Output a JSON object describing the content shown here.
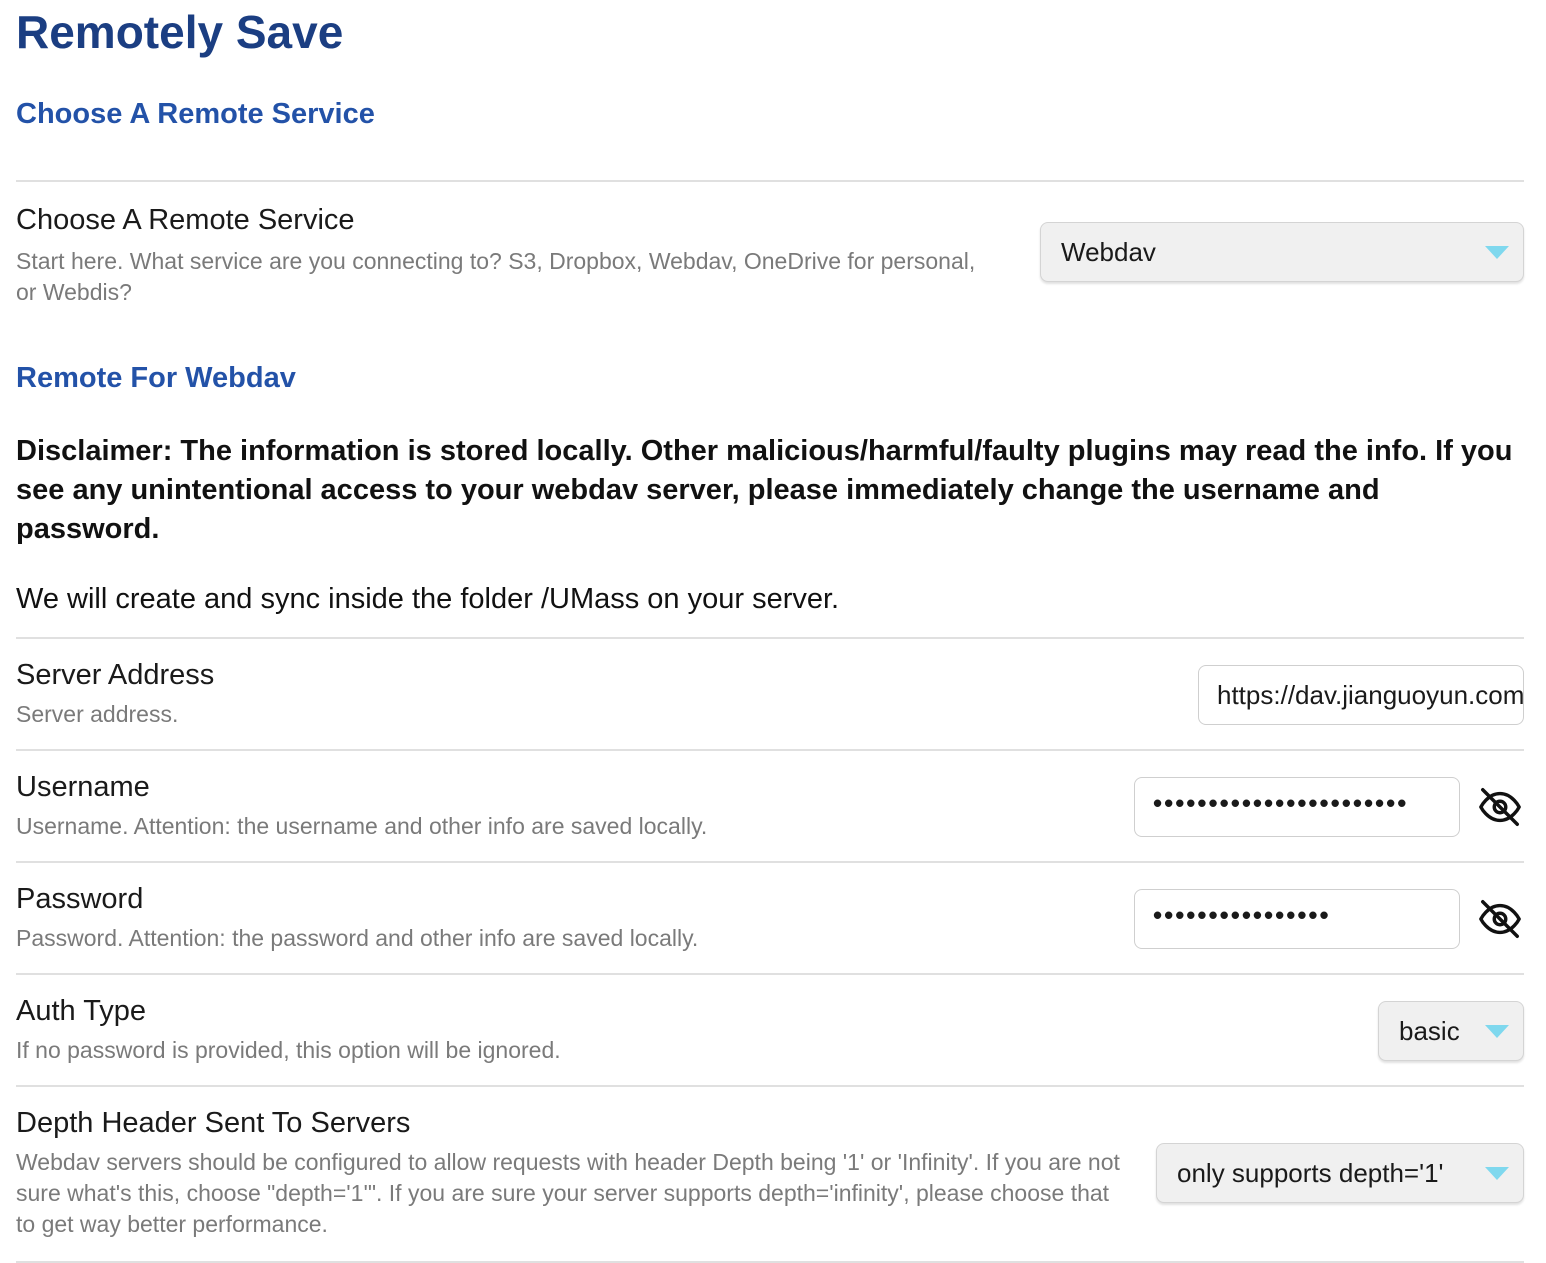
{
  "page": {
    "title": "Remotely Save"
  },
  "choose_section": {
    "heading": "Choose A Remote Service",
    "setting": {
      "name": "Choose A Remote Service",
      "description": "Start here. What service are you connecting to? S3, Dropbox, Webdav, OneDrive for personal, or Webdis?",
      "value": "Webdav"
    }
  },
  "webdav_section": {
    "heading": "Remote For Webdav",
    "disclaimer": "Disclaimer: The information is stored locally. Other malicious/harmful/faulty plugins may read the info. If you see any unintentional access to your webdav server, please immediately change the username and password.",
    "folder_note": "We will create and sync inside the folder /UMass on your server."
  },
  "server_address": {
    "name": "Server Address",
    "description": "Server address.",
    "value": "https://dav.jianguoyun.com/dav/"
  },
  "username": {
    "name": "Username",
    "description": "Username. Attention: the username and other info are saved locally.",
    "masked_value": "•••••••••••••••••••••••",
    "toggle_icon": "eye-off-icon"
  },
  "password": {
    "name": "Password",
    "description": "Password. Attention: the password and other info are saved locally.",
    "masked_value": "••••••••••••••••",
    "toggle_icon": "eye-off-icon"
  },
  "auth_type": {
    "name": "Auth Type",
    "description": "If no password is provided, this option will be ignored.",
    "value": "basic"
  },
  "depth_header": {
    "name": "Depth Header Sent To Servers",
    "description": "Webdav servers should be configured to allow requests with header Depth being '1' or 'Infinity'. If you are not sure what's this, choose \"depth='1'\". If you are sure your server supports depth='infinity', please choose that to get way better performance.",
    "value": "only supports depth='1'"
  },
  "colors": {
    "title": "#1b3e82",
    "section_heading": "#2352a8",
    "description_text": "#7a7a7a",
    "caret": "#7fd8ee",
    "divider": "#e0e0e0"
  }
}
